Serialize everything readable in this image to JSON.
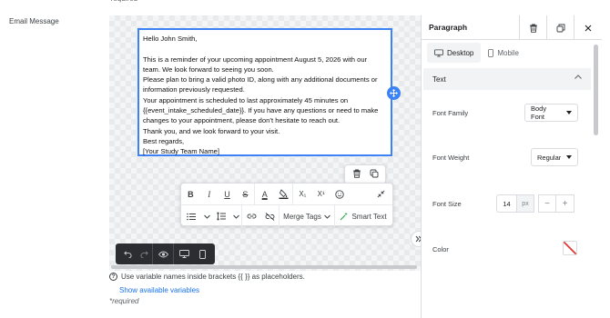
{
  "form": {
    "top_required_clip": "required",
    "field_label": "Email Message",
    "hint_text": "Use variable names inside brackets {{ }} as placeholders.",
    "show_vars_link": "Show available variables",
    "required_note": "*required"
  },
  "editor": {
    "lines": [
      "Hello John Smith,",
      "",
      "This is a reminder of your upcoming appointment August 5, 2026 with our",
      "team. We look forward to seeing you soon.",
      "Please plan to bring a valid photo ID, along with any additional documents or",
      "information previously requested.",
      "Your appointment is scheduled to last approximately 45 minutes on",
      "{{event_intake_scheduled_date}}. If you have any questions or need to make",
      "changes to your appointment, please don’t hesitate to reach out.",
      "Thank you, and we look forward to your visit.",
      "Best regards,",
      "[Your Study Team Name]"
    ]
  },
  "toolbar": {
    "bold": "B",
    "italic": "I",
    "underline": "U",
    "strike": "S",
    "font_color": "A",
    "subscript": "X₁",
    "superscript": "X¹",
    "merge_tags_label": "Merge Tags",
    "smart_text_label": "Smart Text"
  },
  "panel": {
    "title": "Paragraph",
    "tabs": [
      {
        "label": "Desktop",
        "active": true
      },
      {
        "label": "Mobile",
        "active": false
      }
    ],
    "section_title": "Text",
    "font_family_label": "Font Family",
    "font_family_value": "Body Font",
    "font_weight_label": "Font Weight",
    "font_weight_value": "Regular",
    "font_size_label": "Font Size",
    "font_size_value": "14",
    "font_size_unit": "px",
    "decrement": "−",
    "increment": "+",
    "color_label": "Color"
  },
  "colors": {
    "accent": "#3b82f6",
    "link": "#1a73e8",
    "toolbar_dark": "#2b2d31",
    "swatch_none": "#e53935"
  }
}
